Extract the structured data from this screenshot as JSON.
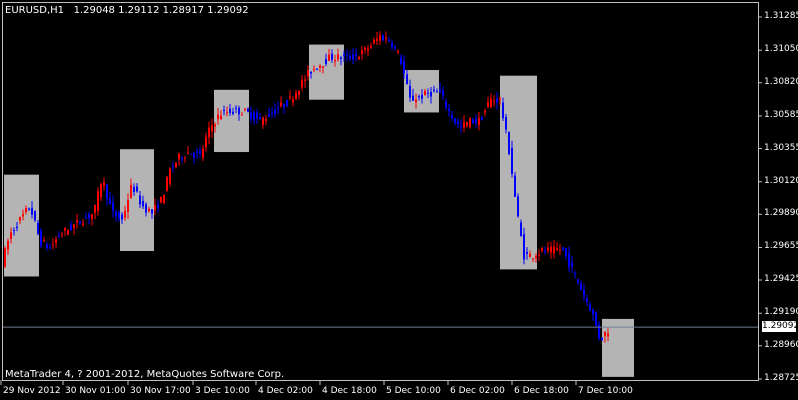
{
  "chart_info": {
    "symbol_timeframe": "EURUSD,H1",
    "ohlc": [
      "1.29048",
      "1.29112",
      "1.28917",
      "1.29092"
    ]
  },
  "copyright": "MetaTrader 4, ? 2001-2012, MetaQuotes Software Corp.",
  "current_price": "1.29092",
  "price_labels": [
    "1.31285",
    "1.31050",
    "1.30820",
    "1.30585",
    "1.30355",
    "1.30120",
    "1.29890",
    "1.29655",
    "1.29425",
    "1.29190",
    "1.28960",
    "1.28725"
  ],
  "time_labels": [
    "29 Nov 2012",
    "30 Nov 01:00",
    "30 Nov 17:00",
    "3 Dec 10:00",
    "4 Dec 02:00",
    "4 Dec 18:00",
    "5 Dec 10:00",
    "6 Dec 02:00",
    "6 Dec 18:00",
    "7 Dec 10:00"
  ],
  "colors": {
    "bull": "#ff0000",
    "bear": "#0000ff",
    "box": "#b4b4b4",
    "grid": "#c0c0c0",
    "current_line": "#708090",
    "background": "#000000"
  },
  "chart_data": {
    "type": "candlestick",
    "title": "EURUSD,H1",
    "ylim": [
      1.28725,
      1.31285
    ],
    "path_points": [
      [
        0,
        1.2955
      ],
      [
        8,
        1.2975
      ],
      [
        18,
        1.2985
      ],
      [
        28,
        1.2995
      ],
      [
        38,
        1.297
      ],
      [
        48,
        1.2965
      ],
      [
        58,
        1.2975
      ],
      [
        70,
        1.298
      ],
      [
        80,
        1.2985
      ],
      [
        92,
        1.299
      ],
      [
        100,
        1.3015
      ],
      [
        110,
        1.299
      ],
      [
        120,
        1.2985
      ],
      [
        130,
        1.301
      ],
      [
        140,
        1.2995
      ],
      [
        150,
        1.299
      ],
      [
        160,
        1.3
      ],
      [
        168,
        1.302
      ],
      [
        178,
        1.303
      ],
      [
        188,
        1.3033
      ],
      [
        198,
        1.303
      ],
      [
        208,
        1.305
      ],
      [
        218,
        1.306
      ],
      [
        228,
        1.3062
      ],
      [
        238,
        1.3062
      ],
      [
        248,
        1.306
      ],
      [
        258,
        1.3055
      ],
      [
        268,
        1.306
      ],
      [
        278,
        1.3065
      ],
      [
        288,
        1.307
      ],
      [
        298,
        1.308
      ],
      [
        308,
        1.309
      ],
      [
        318,
        1.3095
      ],
      [
        328,
        1.31
      ],
      [
        338,
        1.31
      ],
      [
        348,
        1.31
      ],
      [
        358,
        1.3102
      ],
      [
        368,
        1.3108
      ],
      [
        378,
        1.3115
      ],
      [
        388,
        1.3112
      ],
      [
        398,
        1.31
      ],
      [
        408,
        1.307
      ],
      [
        418,
        1.3072
      ],
      [
        428,
        1.3075
      ],
      [
        438,
        1.3075
      ],
      [
        448,
        1.306
      ],
      [
        458,
        1.305
      ],
      [
        468,
        1.3055
      ],
      [
        478,
        1.3055
      ],
      [
        488,
        1.307
      ],
      [
        498,
        1.307
      ],
      [
        508,
        1.303
      ],
      [
        515,
        1.299
      ],
      [
        522,
        1.296
      ],
      [
        530,
        1.296
      ],
      [
        540,
        1.2963
      ],
      [
        550,
        1.2963
      ],
      [
        560,
        1.2965
      ],
      [
        570,
        1.295
      ],
      [
        580,
        1.2935
      ],
      [
        590,
        1.292
      ],
      [
        598,
        1.29
      ],
      [
        605,
        1.2907
      ]
    ],
    "boxes": [
      {
        "t": [
          0,
          35
        ],
        "range": [
          1.2945,
          1.3017
        ]
      },
      {
        "t": [
          116,
          150
        ],
        "range": [
          1.2963,
          1.3035
        ]
      },
      {
        "t": [
          210,
          245
        ],
        "range": [
          1.3033,
          1.3077
        ]
      },
      {
        "t": [
          305,
          340
        ],
        "range": [
          1.307,
          1.3109
        ]
      },
      {
        "t": [
          400,
          435
        ],
        "range": [
          1.3061,
          1.3091
        ]
      },
      {
        "t": [
          496,
          533
        ],
        "range": [
          1.295,
          1.3087
        ]
      },
      {
        "t": [
          598,
          630
        ],
        "range": [
          1.2874,
          1.2915
        ]
      }
    ]
  }
}
